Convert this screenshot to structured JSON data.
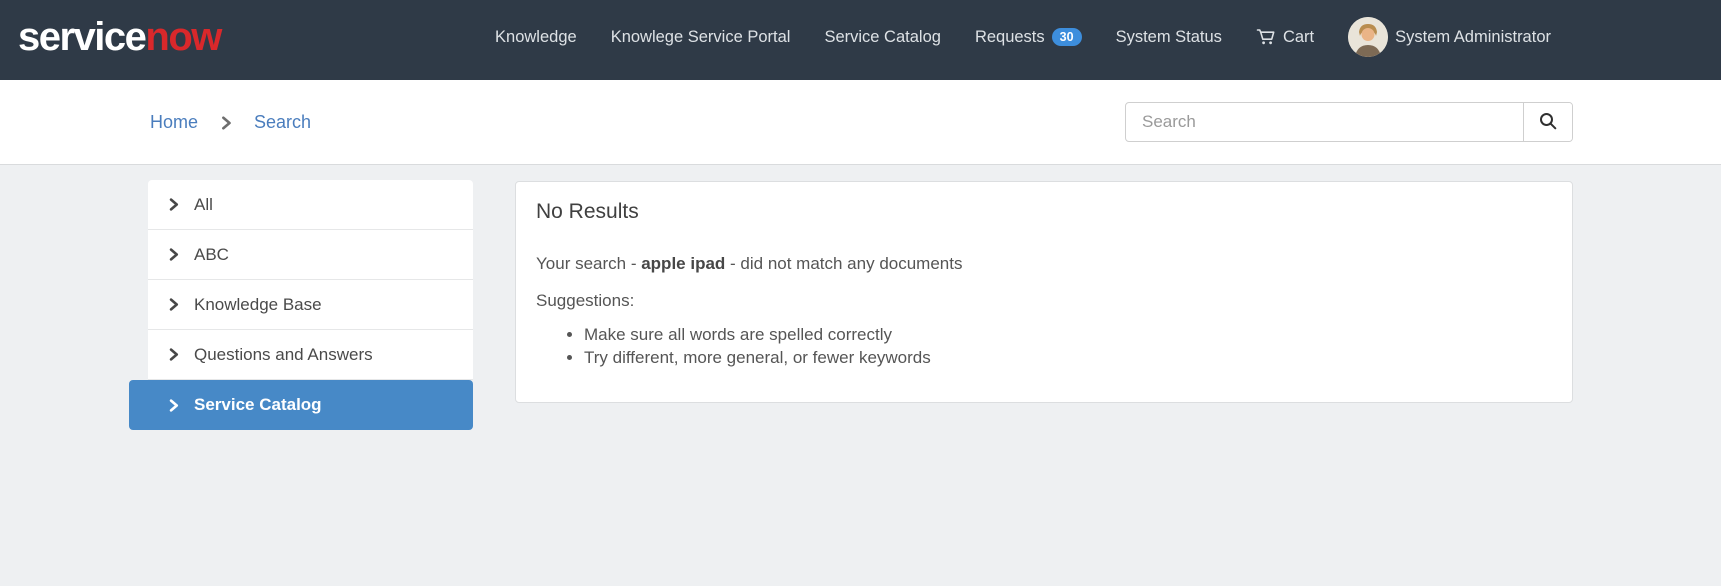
{
  "colors": {
    "topnav_bg": "#2f3a47",
    "logo_red": "#d9282b",
    "badge_blue": "#3d8edd",
    "link_blue": "#4a7dbd",
    "facet_active_blue": "#4789c7",
    "content_bg": "#eef0f2"
  },
  "nav": {
    "logo": {
      "part1": "service",
      "part2": "now"
    },
    "items": [
      {
        "label": "Knowledge"
      },
      {
        "label": "Knowlege Service Portal"
      },
      {
        "label": "Service Catalog"
      },
      {
        "label": "Requests",
        "badge": "30"
      },
      {
        "label": "System Status"
      },
      {
        "label": "Cart",
        "icon": "cart-icon"
      },
      {
        "label": "System Administrator",
        "icon": "avatar-photo"
      }
    ]
  },
  "breadcrumb": {
    "items": [
      {
        "label": "Home"
      },
      {
        "label": "Search"
      }
    ],
    "separator_icon": "chevron-right-icon"
  },
  "search": {
    "placeholder": "Search",
    "value": "",
    "button_icon": "magnifier-icon"
  },
  "facets": {
    "items": [
      {
        "label": "All",
        "active": false,
        "icon": "chevron-right-icon"
      },
      {
        "label": "ABC",
        "active": false,
        "icon": "chevron-right-icon"
      },
      {
        "label": "Knowledge Base",
        "active": false,
        "icon": "chevron-right-icon"
      },
      {
        "label": "Questions and Answers",
        "active": false,
        "icon": "chevron-right-icon"
      },
      {
        "label": "Service Catalog",
        "active": true,
        "icon": "chevron-right-icon"
      }
    ]
  },
  "results": {
    "title": "No Results",
    "message": {
      "prefix": "Your search - ",
      "query": "apple ipad",
      "suffix": " - did not match any documents"
    },
    "suggestions_label": "Suggestions:",
    "suggestions": [
      "Make sure all words are spelled correctly",
      "Try different, more general, or fewer keywords"
    ]
  }
}
